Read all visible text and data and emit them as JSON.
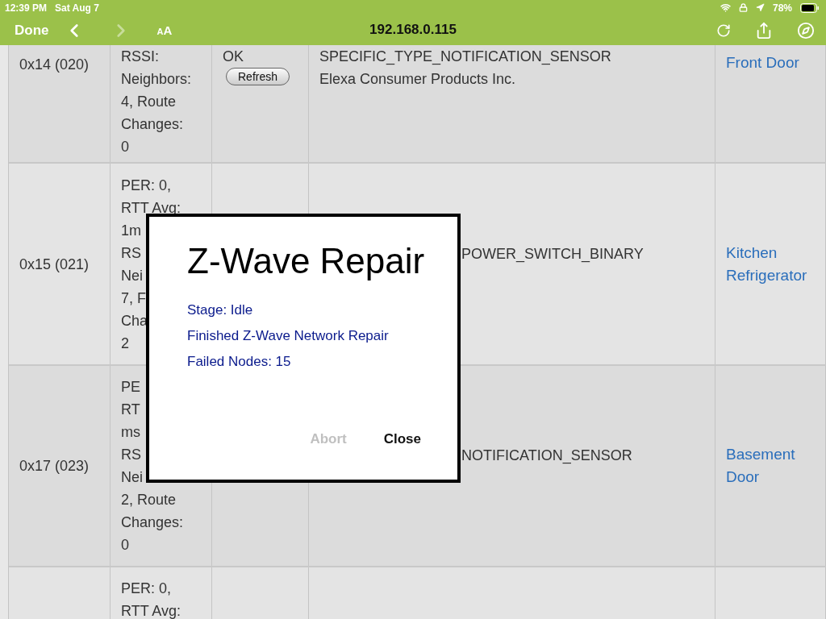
{
  "status_bar": {
    "time": "12:39 PM",
    "date": "Sat Aug 7",
    "battery": "78%"
  },
  "toolbar": {
    "done": "Done",
    "text_size": "AA",
    "address": "192.168.0.115",
    "forward_disabled": true
  },
  "table": {
    "rows": [
      {
        "address": "0x14 (020)",
        "stats": [
          "RSSI:",
          "Neighbors:",
          "4, Route",
          "Changes:",
          "0"
        ],
        "status": "OK",
        "action": "Refresh",
        "type": [
          "SPECIFIC_TYPE_NOTIFICATION_SENSOR",
          "Elexa Consumer Products Inc."
        ],
        "name": "Front Door"
      },
      {
        "address": "0x15 (021)",
        "stats": [
          "PER: 0,",
          "RTT Avg:",
          "1m",
          "RS",
          "Nei",
          "7, F",
          "Cha",
          "2"
        ],
        "type": [
          "POWER_SWITCH_BINARY"
        ],
        "name": "Kitchen Refrigerator"
      },
      {
        "address": "0x17 (023)",
        "stats": [
          "PE",
          "RT",
          "ms",
          "RS",
          "Nei",
          "2, Route",
          "Changes:",
          "0"
        ],
        "type": [
          "NOTIFICATION_SENSOR"
        ],
        "name": "Basement Door"
      },
      {
        "stats": [
          "PER: 0,",
          "RTT Avg:"
        ]
      }
    ]
  },
  "dialog": {
    "title": "Z-Wave Repair",
    "lines": [
      "Stage: Idle",
      "Finished Z-Wave Network Repair",
      "Failed Nodes: 15"
    ],
    "buttons": [
      {
        "label": "Abort",
        "disabled": true
      },
      {
        "label": "Close",
        "disabled": false
      }
    ]
  }
}
